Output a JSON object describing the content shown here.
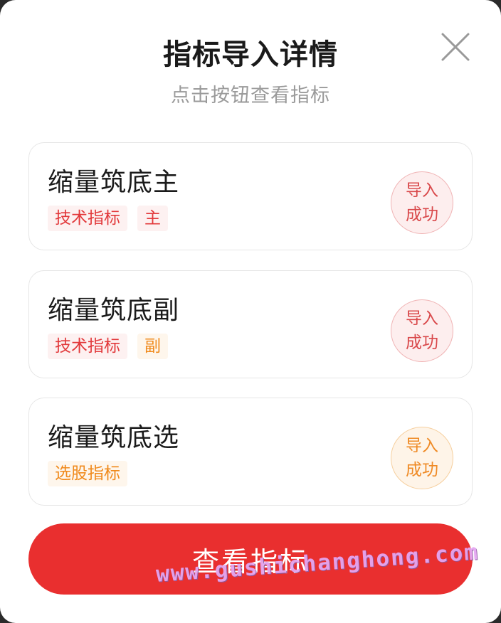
{
  "dialog": {
    "title": "指标导入详情",
    "subtitle": "点击按钮查看指标",
    "close_icon": "close-icon"
  },
  "items": [
    {
      "name": "缩量筑底主",
      "tags": [
        {
          "label": "技术指标",
          "color": "red"
        },
        {
          "label": "主",
          "color": "red"
        }
      ],
      "status": {
        "line1": "导入",
        "line2": "成功",
        "color": "red"
      }
    },
    {
      "name": "缩量筑底副",
      "tags": [
        {
          "label": "技术指标",
          "color": "red"
        },
        {
          "label": "副",
          "color": "orange"
        }
      ],
      "status": {
        "line1": "导入",
        "line2": "成功",
        "color": "red"
      }
    },
    {
      "name": "缩量筑底选",
      "tags": [
        {
          "label": "选股指标",
          "color": "orange"
        }
      ],
      "status": {
        "line1": "导入",
        "line2": "成功",
        "color": "orange"
      }
    }
  ],
  "actions": {
    "view_label": "查看指标"
  },
  "watermark": "www.gushichanghong.com",
  "colors": {
    "accent": "#e92f2f",
    "tag_red": "#e2393b",
    "tag_orange": "#f08a1c"
  }
}
